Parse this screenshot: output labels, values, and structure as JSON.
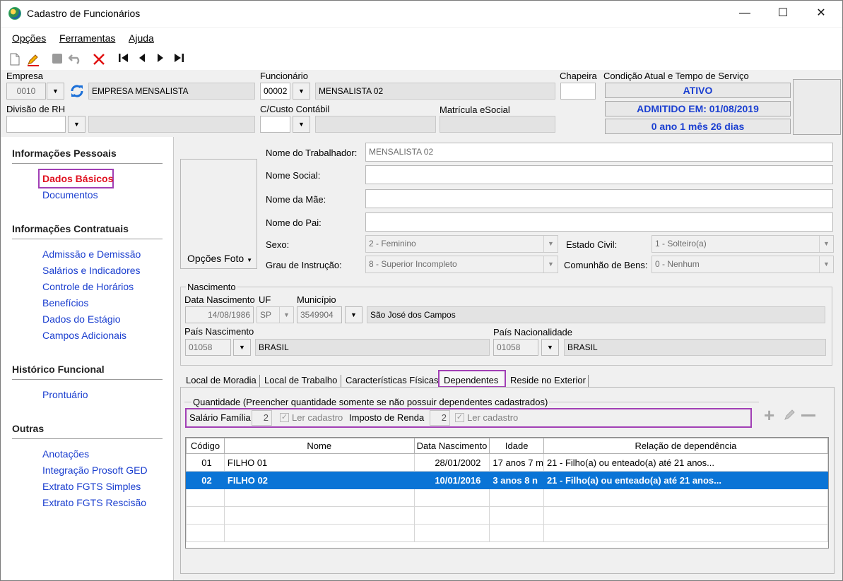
{
  "window": {
    "title": "Cadastro de Funcionários",
    "minimize": "—",
    "maximize": "☐",
    "close": "✕"
  },
  "menu": {
    "opcoes": "Opções",
    "ferramentas": "Ferramentas",
    "ajuda": "Ajuda"
  },
  "toolbar": {
    "icons": [
      "new-document-icon",
      "edit-icon",
      "stop-icon",
      "undo-icon",
      "delete-icon",
      "first-record-icon",
      "previous-record-icon",
      "next-record-icon",
      "last-record-icon"
    ]
  },
  "header": {
    "empresa_label": "Empresa",
    "empresa_code": "0010",
    "empresa_name": "EMPRESA MENSALISTA",
    "funcionario_label": "Funcionário",
    "funcionario_code": "00002",
    "funcionario_name": "MENSALISTA 02",
    "chapeira_label": "Chapeira",
    "chapeira_value": "",
    "condicao_label": "Condição Atual e Tempo de Serviço",
    "status": "ATIVO",
    "admitido": "ADMITIDO EM: 01/08/2019",
    "tempo": "0 ano 1 mês 26 dias",
    "divisao_label": "Divisão de RH",
    "divisao_value": "",
    "ccusto_label": "C/Custo Contábil",
    "ccusto_value": "",
    "matricula_label": "Matrícula eSocial",
    "matricula_value": ""
  },
  "sidebar": {
    "sections": [
      {
        "title": "Informações Pessoais",
        "items": [
          "Dados Básicos",
          "Documentos"
        ]
      },
      {
        "title": "Informações Contratuais",
        "items": [
          "Admissão e Demissão",
          "Salários e Indicadores",
          "Controle de Horários",
          "Benefícios",
          "Dados do Estágio",
          "Campos Adicionais"
        ]
      },
      {
        "title": "Histórico Funcional",
        "items": [
          "Prontuário"
        ]
      },
      {
        "title": "Outras",
        "items": [
          "Anotações",
          "Integração Prosoft GED",
          "Extrato FGTS Simples",
          "Extrato FGTS Rescisão"
        ]
      }
    ],
    "active_item": "Dados Básicos"
  },
  "form": {
    "photo_button": "Opções Foto",
    "nome_trabalhador_label": "Nome do Trabalhador:",
    "nome_trabalhador": "MENSALISTA 02",
    "nome_social_label": "Nome Social:",
    "nome_social": "",
    "nome_mae_label": "Nome da Mãe:",
    "nome_mae": "",
    "nome_pai_label": "Nome do Pai:",
    "nome_pai": "",
    "sexo_label": "Sexo:",
    "sexo": "2 - Feminino",
    "estado_civil_label": "Estado Civil:",
    "estado_civil": "1 - Solteiro(a)",
    "grau_label": "Grau de Instrução:",
    "grau": "8 - Superior Incompleto",
    "comunhao_label": "Comunhão de Bens:",
    "comunhao": "0 - Nenhum"
  },
  "nascimento": {
    "group_label": "Nascimento",
    "data_label": "Data Nascimento",
    "data": "14/08/1986",
    "uf_label": "UF",
    "uf": "SP",
    "municipio_label": "Município",
    "municipio_code": "3549904",
    "municipio_name": "São José dos Campos",
    "pais_nasc_label": "País Nascimento",
    "pais_nasc_code": "01058",
    "pais_nasc_name": "BRASIL",
    "pais_nac_label": "País Nacionalidade",
    "pais_nac_code": "01058",
    "pais_nac_name": "BRASIL"
  },
  "tabs": {
    "items": [
      "Local de Moradia",
      "Local de Trabalho",
      "Características Físicas",
      "Dependentes",
      "Reside no Exterior"
    ],
    "active": "Dependentes"
  },
  "dependentes": {
    "quantidade_label": "Quantidade (Preencher quantidade somente se não possuir dependentes cadastrados)",
    "salario_familia_label": "Salário Família",
    "salario_familia_qty": "2",
    "ler_cadastro_1": "Ler cadastro",
    "imposto_renda_label": "Imposto de Renda",
    "imposto_renda_qty": "2",
    "ler_cadastro_2": "Ler cadastro",
    "columns": [
      "Código",
      "Nome",
      "Data Nascimento",
      "Idade",
      "Relação de dependência"
    ],
    "rows": [
      {
        "codigo": "01",
        "nome": "FILHO 01",
        "data": "28/01/2002",
        "idade": "17 anos 7 m",
        "relacao": "21 - Filho(a) ou enteado(a) até 21 anos..."
      },
      {
        "codigo": "02",
        "nome": "FILHO 02",
        "data": "10/01/2016",
        "idade": "3 anos 8 n",
        "relacao": "21 - Filho(a) ou enteado(a) até 21 anos..."
      }
    ],
    "selected_row": 1
  }
}
